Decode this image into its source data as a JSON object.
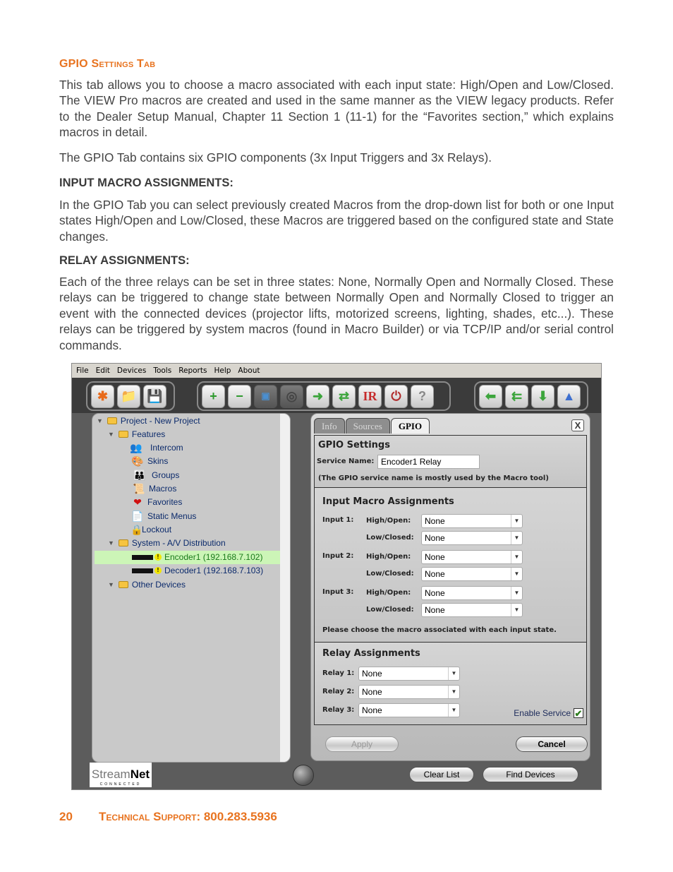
{
  "doc": {
    "section_title": "GPIO Settings Tab",
    "intro": "This tab allows you to choose a macro associated with each input state: High/Open and Low/Closed. The VIEW Pro macros are created and used in the same manner as the VIEW legacy products. Refer to the Dealer Setup Manual, Chapter 11 Section 1 (11-1) for the “Favorites section,” which explains macros in detail.",
    "components": "The GPIO Tab contains six GPIO components (3x Input Triggers and 3x Relays).",
    "input_heading": "INPUT MACRO ASSIGNMENTS:",
    "input_body": "In the GPIO Tab you can select previously created Macros from the drop-down list for both or one Input states High/Open and Low/Closed, these Macros are triggered based on the configured state and State changes.",
    "relay_heading": "RELAY ASSIGNMENTS:",
    "relay_body": "Each of the three relays can be set in three states: None, Normally Open and Normally Closed. These relays can be triggered to change state between Normally Open and Normally Closed to trigger an event with the connected devices (projector lifts, motorized screens, lighting, shades, etc...). These relays can be triggered by system macros (found in Macro Builder) or via TCP/IP and/or serial control commands.",
    "footer_page": "20",
    "footer_text": "Technical Support: 800.283.5936"
  },
  "app": {
    "menu": [
      "File",
      "Edit",
      "Devices",
      "Tools",
      "Reports",
      "Help",
      "About"
    ],
    "toolbar": {
      "group1": [
        "new-project-icon",
        "open-folder-icon",
        "save-icon"
      ],
      "group2": [
        "add-device-icon",
        "remove-device-icon",
        "link-devices-icon",
        "fingerprint-icon",
        "network-arrow-icon",
        "network-sync-icon",
        "ir-icon",
        "power-cycle-icon",
        "help-icon"
      ],
      "group3": [
        "import-icon",
        "import-multi-icon",
        "firmware-download-icon",
        "wizard-icon"
      ],
      "ir_label": "IR",
      "help_label": "?"
    },
    "tree": {
      "project": "Project - New Project",
      "features": "Features",
      "feature_items": [
        "Intercom",
        "Skins",
        "Groups",
        "Macros",
        "Favorites",
        "Static Menus",
        "Lockout"
      ],
      "system": "System - A/V Distribution",
      "devices": [
        "Encoder1 (192.168.7.102)",
        "Decoder1 (192.168.7.103)"
      ],
      "other": "Other Devices"
    },
    "tabs": [
      "Info",
      "Sources",
      "GPIO"
    ],
    "active_tab": "GPIO",
    "close_label": "X",
    "gpio": {
      "title": "GPIO Settings",
      "service_name_label": "Service Name:",
      "service_name_value": "Encoder1 Relay",
      "service_note": "(The GPIO service name is mostly used by the Macro tool)",
      "input_title": "Input Macro Assignments",
      "inputs": [
        {
          "label": "Input 1:",
          "high_label": "High/Open:",
          "high_value": "None",
          "low_label": "Low/Closed:",
          "low_value": "None"
        },
        {
          "label": "Input 2:",
          "high_label": "High/Open:",
          "high_value": "None",
          "low_label": "Low/Closed:",
          "low_value": "None"
        },
        {
          "label": "Input 3:",
          "high_label": "High/Open:",
          "high_value": "None",
          "low_label": "Low/Closed:",
          "low_value": "None"
        }
      ],
      "input_note": "Please choose the macro associated with each input state.",
      "relay_title": "Relay Assignments",
      "relays": [
        {
          "label": "Relay 1:",
          "value": "None"
        },
        {
          "label": "Relay 2:",
          "value": "None"
        },
        {
          "label": "Relay 3:",
          "value": "None"
        }
      ],
      "enable_service_label": "Enable Service",
      "enable_service_checked": true
    },
    "buttons": {
      "apply": "Apply",
      "cancel": "Cancel",
      "clear_list": "Clear List",
      "find_devices": "Find Devices"
    },
    "logo": {
      "brand_light": "Stream",
      "brand_bold": "Net",
      "tagline": "CONNECTED"
    }
  },
  "colors": {
    "accent": "#e8731f",
    "selection": "#ccf5b7",
    "tree_text": "#0b2a6b"
  }
}
